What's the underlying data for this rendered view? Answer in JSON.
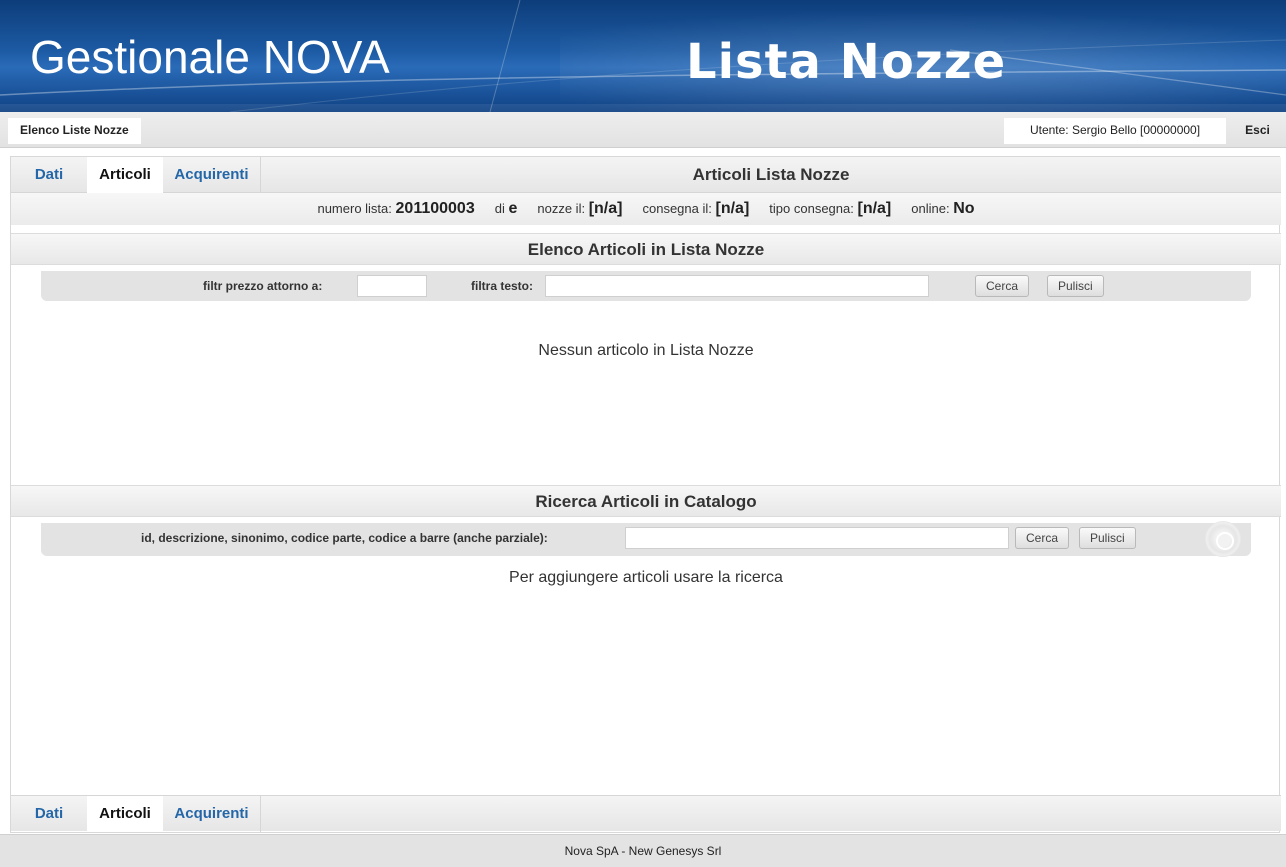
{
  "header": {
    "app_name": "Gestionale NOVA",
    "module_name": "Lista Nozze"
  },
  "topbar": {
    "crumb": "Elenco Liste Nozze",
    "user": "Utente: Sergio Bello [00000000]",
    "logout": "Esci"
  },
  "tabs": {
    "dati": "Dati",
    "articoli": "Articoli",
    "acquirenti": "Acquirenti",
    "active": "Articoli",
    "title": "Articoli Lista Nozze"
  },
  "info": {
    "numero_label": "numero lista:",
    "numero_value": "201100003",
    "di_label": "di",
    "di_value": "e",
    "nozze_label": "nozze il:",
    "nozze_value": "[n/a]",
    "consegna_label": "consegna il:",
    "consegna_value": "[n/a]",
    "tipo_label": "tipo consegna:",
    "tipo_value": "[n/a]",
    "online_label": "online:",
    "online_value": "No"
  },
  "elenco": {
    "title": "Elenco Articoli in Lista Nozze",
    "price_label": "filtr prezzo attorno a:",
    "price_value": "",
    "text_label": "filtra testo:",
    "text_value": "",
    "search_button": "Cerca",
    "clear_button": "Pulisci",
    "empty_message": "Nessun articolo in Lista Nozze"
  },
  "ricerca": {
    "title": "Ricerca Articoli in Catalogo",
    "query_label": "id, descrizione, sinonimo, codice parte, codice a barre (anche parziale):",
    "query_value": "",
    "search_button": "Cerca",
    "clear_button": "Pulisci",
    "hint_message": "Per aggiungere articoli usare la ricerca"
  },
  "footer": {
    "text": "Nova SpA - New Genesys Srl"
  },
  "colors": {
    "banner_dark": "#0d3d7a",
    "banner_mid": "#2a6bb8",
    "tab_link": "#2467a8"
  }
}
